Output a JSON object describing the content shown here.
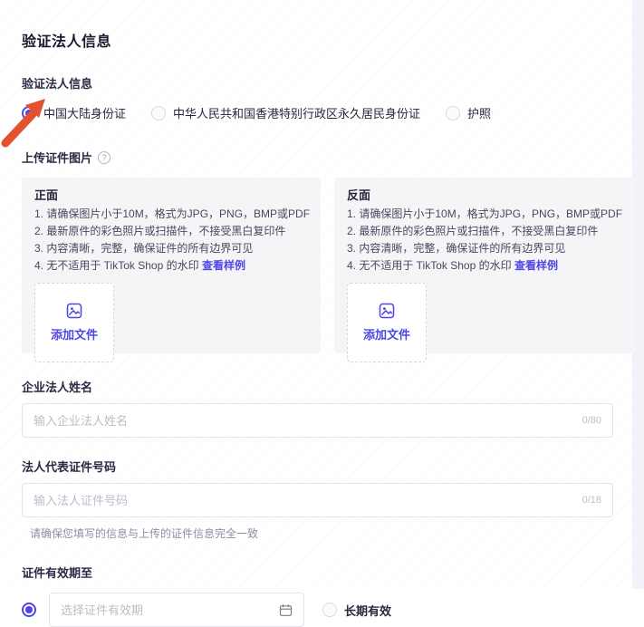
{
  "colors": {
    "accent": "#4f46e5",
    "arrow": "#e2522e"
  },
  "page": {
    "title": "验证法人信息"
  },
  "id_type": {
    "label": "验证法人信息",
    "options": [
      {
        "label": "中国大陆身份证",
        "selected": true
      },
      {
        "label": "中华人民共和国香港特别行政区永久居民身份证",
        "selected": false
      },
      {
        "label": "护照",
        "selected": false
      }
    ]
  },
  "upload": {
    "label": "上传证件图片",
    "help_icon": "?",
    "cards": [
      {
        "title": "正面",
        "rules": [
          "1. 请确保图片小于10M，格式为JPG，PNG，BMP或PDF",
          "2. 最新原件的彩色照片或扫描件，不接受黑白复印件",
          "3. 内容清晰，完整，确保证件的所有边界可见",
          "4. 无不适用于 TikTok Shop 的水印"
        ],
        "sample_link": "查看样例",
        "add_label": "添加文件"
      },
      {
        "title": "反面",
        "rules": [
          "1. 请确保图片小于10M，格式为JPG，PNG，BMP或PDF",
          "2. 最新原件的彩色照片或扫描件，不接受黑白复印件",
          "3. 内容清晰，完整，确保证件的所有边界可见",
          "4. 无不适用于 TikTok Shop 的水印"
        ],
        "sample_link": "查看样例",
        "add_label": "添加文件"
      }
    ]
  },
  "legal_name": {
    "label": "企业法人姓名",
    "placeholder": "输入企业法人姓名",
    "value": "",
    "counter": "0/80"
  },
  "id_number": {
    "label": "法人代表证件号码",
    "placeholder": "输入法人证件号码",
    "value": "",
    "counter": "0/18",
    "helper": "请确保您填写的信息与上传的证件信息完全一致"
  },
  "validity": {
    "label": "证件有效期至",
    "date_placeholder": "选择证件有效期",
    "date_value": "",
    "long_term_label": "长期有效"
  }
}
